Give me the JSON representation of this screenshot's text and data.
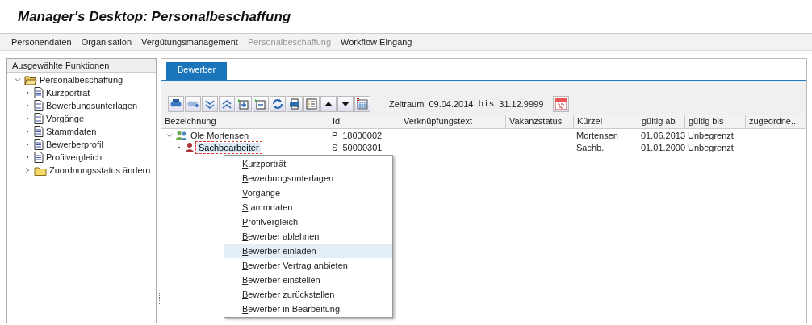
{
  "window": {
    "title": "Manager's Desktop: Personalbeschaffung"
  },
  "menu_bar": [
    {
      "label": "Personendaten",
      "disabled": false
    },
    {
      "label": "Organisation",
      "disabled": false
    },
    {
      "label": "Vergütungsmanagement",
      "disabled": false
    },
    {
      "label": "Personalbeschaffung",
      "disabled": true
    },
    {
      "label": "Workflow Eingang",
      "disabled": false
    }
  ],
  "sidebar": {
    "title": "Ausgewählte Funktionen",
    "tree": [
      {
        "label": "Personalbeschaffung",
        "kind": "folder",
        "expanded": true,
        "children": [
          {
            "label": "Kurzporträt",
            "kind": "document"
          },
          {
            "label": "Bewerbungsunterlagen",
            "kind": "document"
          },
          {
            "label": "Vorgänge",
            "kind": "document"
          },
          {
            "label": "Stammdaten",
            "kind": "document"
          },
          {
            "label": "Bewerberprofil",
            "kind": "document"
          },
          {
            "label": "Profilvergleich",
            "kind": "document"
          },
          {
            "label": "Zuordnungsstatus ändern",
            "kind": "folder",
            "expanded": false
          }
        ]
      }
    ]
  },
  "tabs": [
    {
      "label": "Bewerber",
      "selected": true
    }
  ],
  "period": {
    "label": "Zeitraum",
    "from": "09.04.2014",
    "separator": "bis",
    "to": "31.12.9999"
  },
  "table": {
    "columns": [
      "Bezeichnung",
      "Id",
      "Verknüpfungstext",
      "Vakanzstatus",
      "Kürzel",
      "gültig ab",
      "gültig bis",
      "zugeordne..."
    ],
    "rows": [
      {
        "kind": "person-group",
        "expanded": true,
        "selected": false,
        "cells": [
          "Ole Mortensen",
          "P  18000002",
          "",
          "",
          "Mortensen",
          "01.06.2013",
          "Unbegrenzt",
          ""
        ],
        "children": [
          {
            "kind": "position",
            "selected": true,
            "cells": [
              "Sachbearbeiter",
              "S  50000301",
              "",
              "",
              "Sachb.",
              "01.01.2000",
              "Unbegrenzt",
              ""
            ]
          }
        ]
      }
    ]
  },
  "context_menu": [
    {
      "label": "Kurzporträt",
      "selected": false
    },
    {
      "label": "Bewerbungsunterlagen",
      "selected": false
    },
    {
      "label": "Vorgänge",
      "selected": false
    },
    {
      "label": "Stammdaten",
      "selected": false
    },
    {
      "label": "Profilvergleich",
      "selected": false
    },
    {
      "label": "Bewerber ablehnen",
      "selected": false
    },
    {
      "label": "Bewerber einladen",
      "selected": true
    },
    {
      "label": "Bewerber Vertrag anbieten",
      "selected": false
    },
    {
      "label": "Bewerber einstellen",
      "selected": false
    },
    {
      "label": "Bewerber zurückstellen",
      "selected": false
    },
    {
      "label": "Bewerber in Bearbeitung",
      "selected": false
    }
  ]
}
